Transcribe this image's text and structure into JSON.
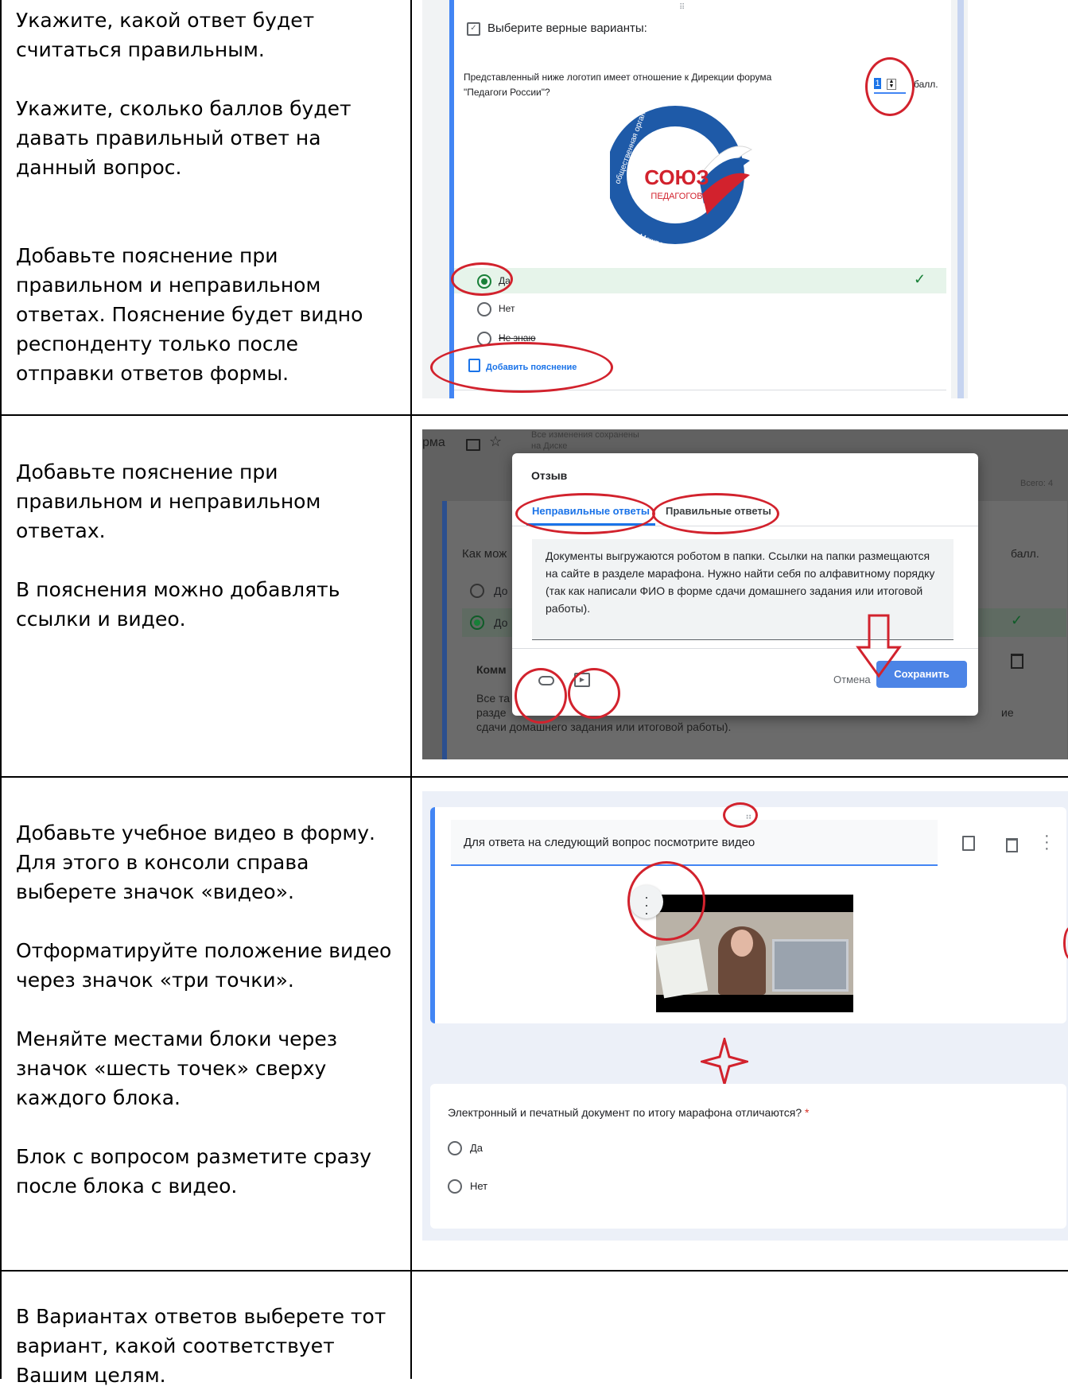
{
  "rows": [
    {
      "paragraphs": [
        "Укажите, какой ответ будет считаться правильным.",
        "Укажите, сколько баллов будет давать правильный ответ на данный вопрос.",
        "",
        "Добавьте пояснение при правильном и неправильном ответах. Пояснение будет видно респонденту только после отправки ответов формы."
      ]
    },
    {
      "paragraphs": [
        "Добавьте пояснение при правильном и неправильном ответах.",
        "В пояснения можно добавлять ссылки и видео."
      ]
    },
    {
      "paragraphs": [
        "Добавьте учебное видео в форму. Для этого в консоли справа выберете значок «видео».",
        "Отформатируйте положение видео через значок «три точки».",
        "Меняйте местами блоки через значок «шесть точек» сверху каждого блока.",
        "Блок с вопросом разметите сразу после блока с видео."
      ]
    },
    {
      "paragraphs": [
        "В Вариантах ответов выберете тот вариант, какой соответствует Вашим целям."
      ]
    }
  ],
  "shot1": {
    "type_label": "Выберите верные варианты:",
    "question": "Представленный ниже логотип имеет отношение к Дирекции форума \"Педагоги России\"?",
    "points_value": "1",
    "points_label": "балл.",
    "logo_top": "СОЮЗ",
    "logo_bottom": "ПЕДАГОГОВ",
    "logo_ring_top": "общественная организация",
    "logo_ring_bottom": "Межрегиональная",
    "options": [
      "Да",
      "Нет",
      "Не знаю"
    ],
    "add_explanation": "Добавить пояснение",
    "check": "✓"
  },
  "shot2": {
    "header_fragment": "рма",
    "saved_line1": "Все изменения сохранены",
    "saved_line2": "на Диске",
    "total": "Всего: 4",
    "bg_question": "Как мож",
    "bg_points": "балл.",
    "bg_opt1": "До",
    "bg_opt2": "До",
    "bg_comment": "Комм",
    "bg_text1": "Все та",
    "bg_text2": "разде",
    "bg_text3": "сдачи домашнего задания или итоговой работы).",
    "bg_text_right": "ие",
    "dialog_title": "Отзыв",
    "tab_wrong": "Неправильные ответы",
    "tab_right": "Правильные ответы",
    "feedback": "Документы выгружаются роботом в папки. Ссылки на папки размещаются на сайте в разделе марафона. Нужно найти себя по алфавитному порядку (так как написали ФИО в форме сдачи домашнего задания или итоговой работы).",
    "cancel": "Отмена",
    "save": "Сохранить"
  },
  "shot3": {
    "video_title": "Для ответа на следующий вопрос посмотрите видео",
    "question": "Электронный и печатный документ по итогу марафона отличаются?",
    "required": "*",
    "options": [
      "Да",
      "Нет"
    ]
  },
  "colors": {
    "accent": "#4285f4",
    "save_button": "#4c84e6",
    "correct_bg": "#e6f4ea",
    "annotation_red": "#d2222d"
  }
}
